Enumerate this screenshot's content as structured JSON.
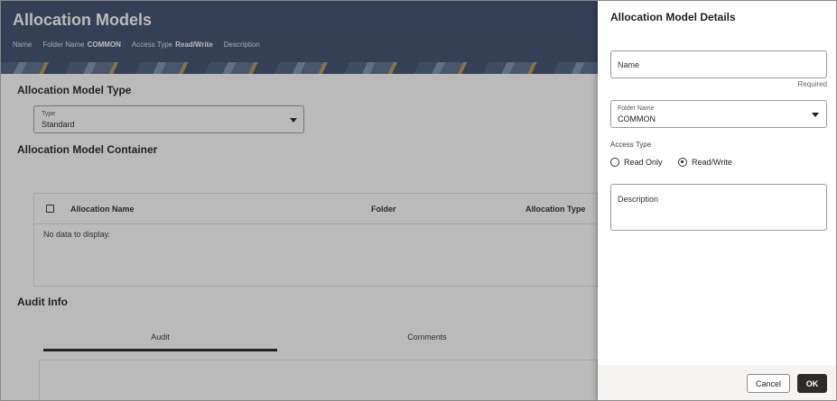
{
  "page": {
    "title": "Allocation Models",
    "meta": {
      "name_label": "Name",
      "folder_label": "Folder Name",
      "folder_value": "COMMON",
      "access_label": "Access Type",
      "access_value": "Read/Write",
      "description_label": "Description"
    },
    "model_type": {
      "heading": "Allocation Model Type",
      "type_label": "Type",
      "type_value": "Standard"
    },
    "container": {
      "heading": "Allocation Model Container",
      "columns": [
        "Allocation Name",
        "Folder",
        "Allocation Type"
      ],
      "empty_text": "No data to display."
    },
    "audit": {
      "heading": "Audit Info",
      "tabs": [
        "Audit",
        "Comments"
      ],
      "active_tab": "Audit"
    }
  },
  "drawer": {
    "title": "Allocation Model Details",
    "name_placeholder": "Name",
    "required_text": "Required",
    "folder_label": "Folder Name",
    "folder_value": "COMMON",
    "access_type_label": "Access Type",
    "access_options": [
      "Read Only",
      "Read/Write"
    ],
    "access_selected": "Read/Write",
    "description_placeholder": "Description",
    "cancel_label": "Cancel",
    "ok_label": "OK"
  },
  "icons": {
    "dropdown": "chevron-down-icon",
    "checkbox": "checkbox-icon",
    "radio": "radio-icon"
  },
  "colors": {
    "header_bg": "#3c4a6b",
    "primary_button": "#2f2b28",
    "footer_bg": "#f6f4f2"
  }
}
